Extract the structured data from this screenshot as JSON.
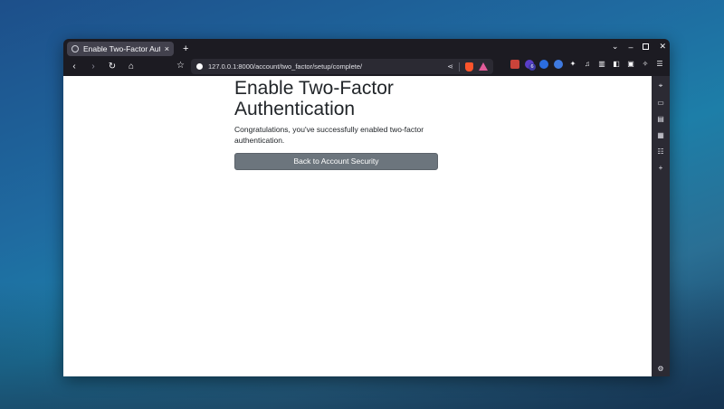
{
  "browser": {
    "tab": {
      "title": "Enable Two-Factor Authe",
      "close_icon": "×"
    },
    "new_tab_icon": "+",
    "window_controls": {
      "dropdown": "⌄",
      "minimize": "–",
      "close": "✕"
    },
    "toolbar": {
      "back_icon": "‹",
      "forward_icon": "›",
      "reload_icon": "↻",
      "home_icon": "⌂",
      "bookmark_icon": "☆"
    },
    "url": "127.0.0.1:8000/account/two_factor/setup/complete/",
    "extension_badge": "6",
    "sidebar_icons": [
      "pin-icon",
      "video-icon",
      "wallet-icon",
      "save-icon",
      "reader-icon",
      "add-icon",
      "settings-icon"
    ]
  },
  "page": {
    "title": "Enable Two-Factor Authentication",
    "message": "Congratulations, you've successfully enabled two-factor authentication.",
    "back_button_label": "Back to Account Security"
  },
  "colors": {
    "button_bg": "#6c757d",
    "browser_chrome": "#1c1b22",
    "urlbar_bg": "#2b2a33"
  }
}
